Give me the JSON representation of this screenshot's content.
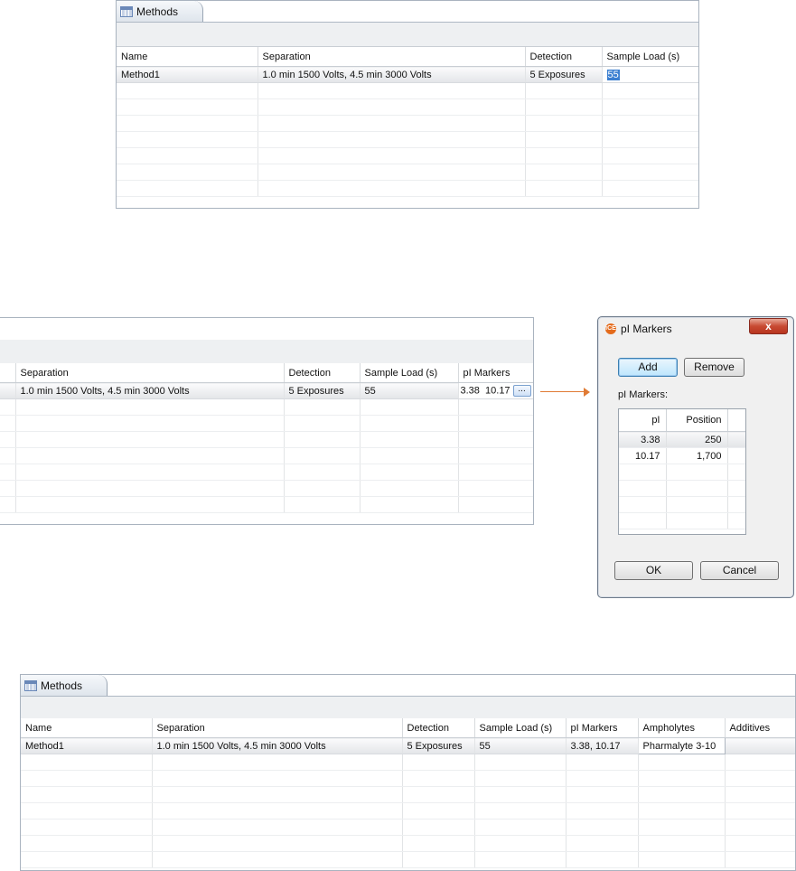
{
  "panel1": {
    "tab_label": "Methods",
    "columns": [
      "Name",
      "Separation",
      "Detection",
      "Sample Load (s)"
    ],
    "row": {
      "name": "Method1",
      "separation": "1.0 min 1500 Volts, 4.5 min 3000 Volts",
      "detection": "5 Exposures",
      "sample_load": "55"
    }
  },
  "panel2": {
    "columns": [
      "Separation",
      "Detection",
      "Sample Load (s)",
      "pI Markers"
    ],
    "row": {
      "separation": "1.0 min 1500 Volts, 4.5 min 3000 Volts",
      "detection": "5 Exposures",
      "sample_load": "55",
      "pi_markers": "3.38  10.17",
      "button": "..."
    }
  },
  "dialog": {
    "icon_text": "iCE",
    "title": "pI Markers",
    "close": "x",
    "add": "Add",
    "remove": "Remove",
    "list_label": "pI Markers:",
    "columns": [
      "pI",
      "Position"
    ],
    "rows": [
      {
        "pi": "3.38",
        "position": "250"
      },
      {
        "pi": "10.17",
        "position": "1,700"
      }
    ],
    "ok": "OK",
    "cancel": "Cancel"
  },
  "panel3": {
    "tab_label": "Methods",
    "columns": [
      "Name",
      "Separation",
      "Detection",
      "Sample Load (s)",
      "pI Markers",
      "Ampholytes",
      "Additives"
    ],
    "row": {
      "name": "Method1",
      "separation": "1.0 min 1500 Volts, 4.5 min 3000 Volts",
      "detection": "5 Exposures",
      "sample_load": "55",
      "pi_markers": "3.38, 10.17",
      "ampholytes": "Pharmalyte 3-10",
      "additives": ""
    }
  },
  "colors": {
    "accent_arrow": "#e07b35",
    "selection": "#3b7fd1",
    "close_button": "#c84a32"
  }
}
